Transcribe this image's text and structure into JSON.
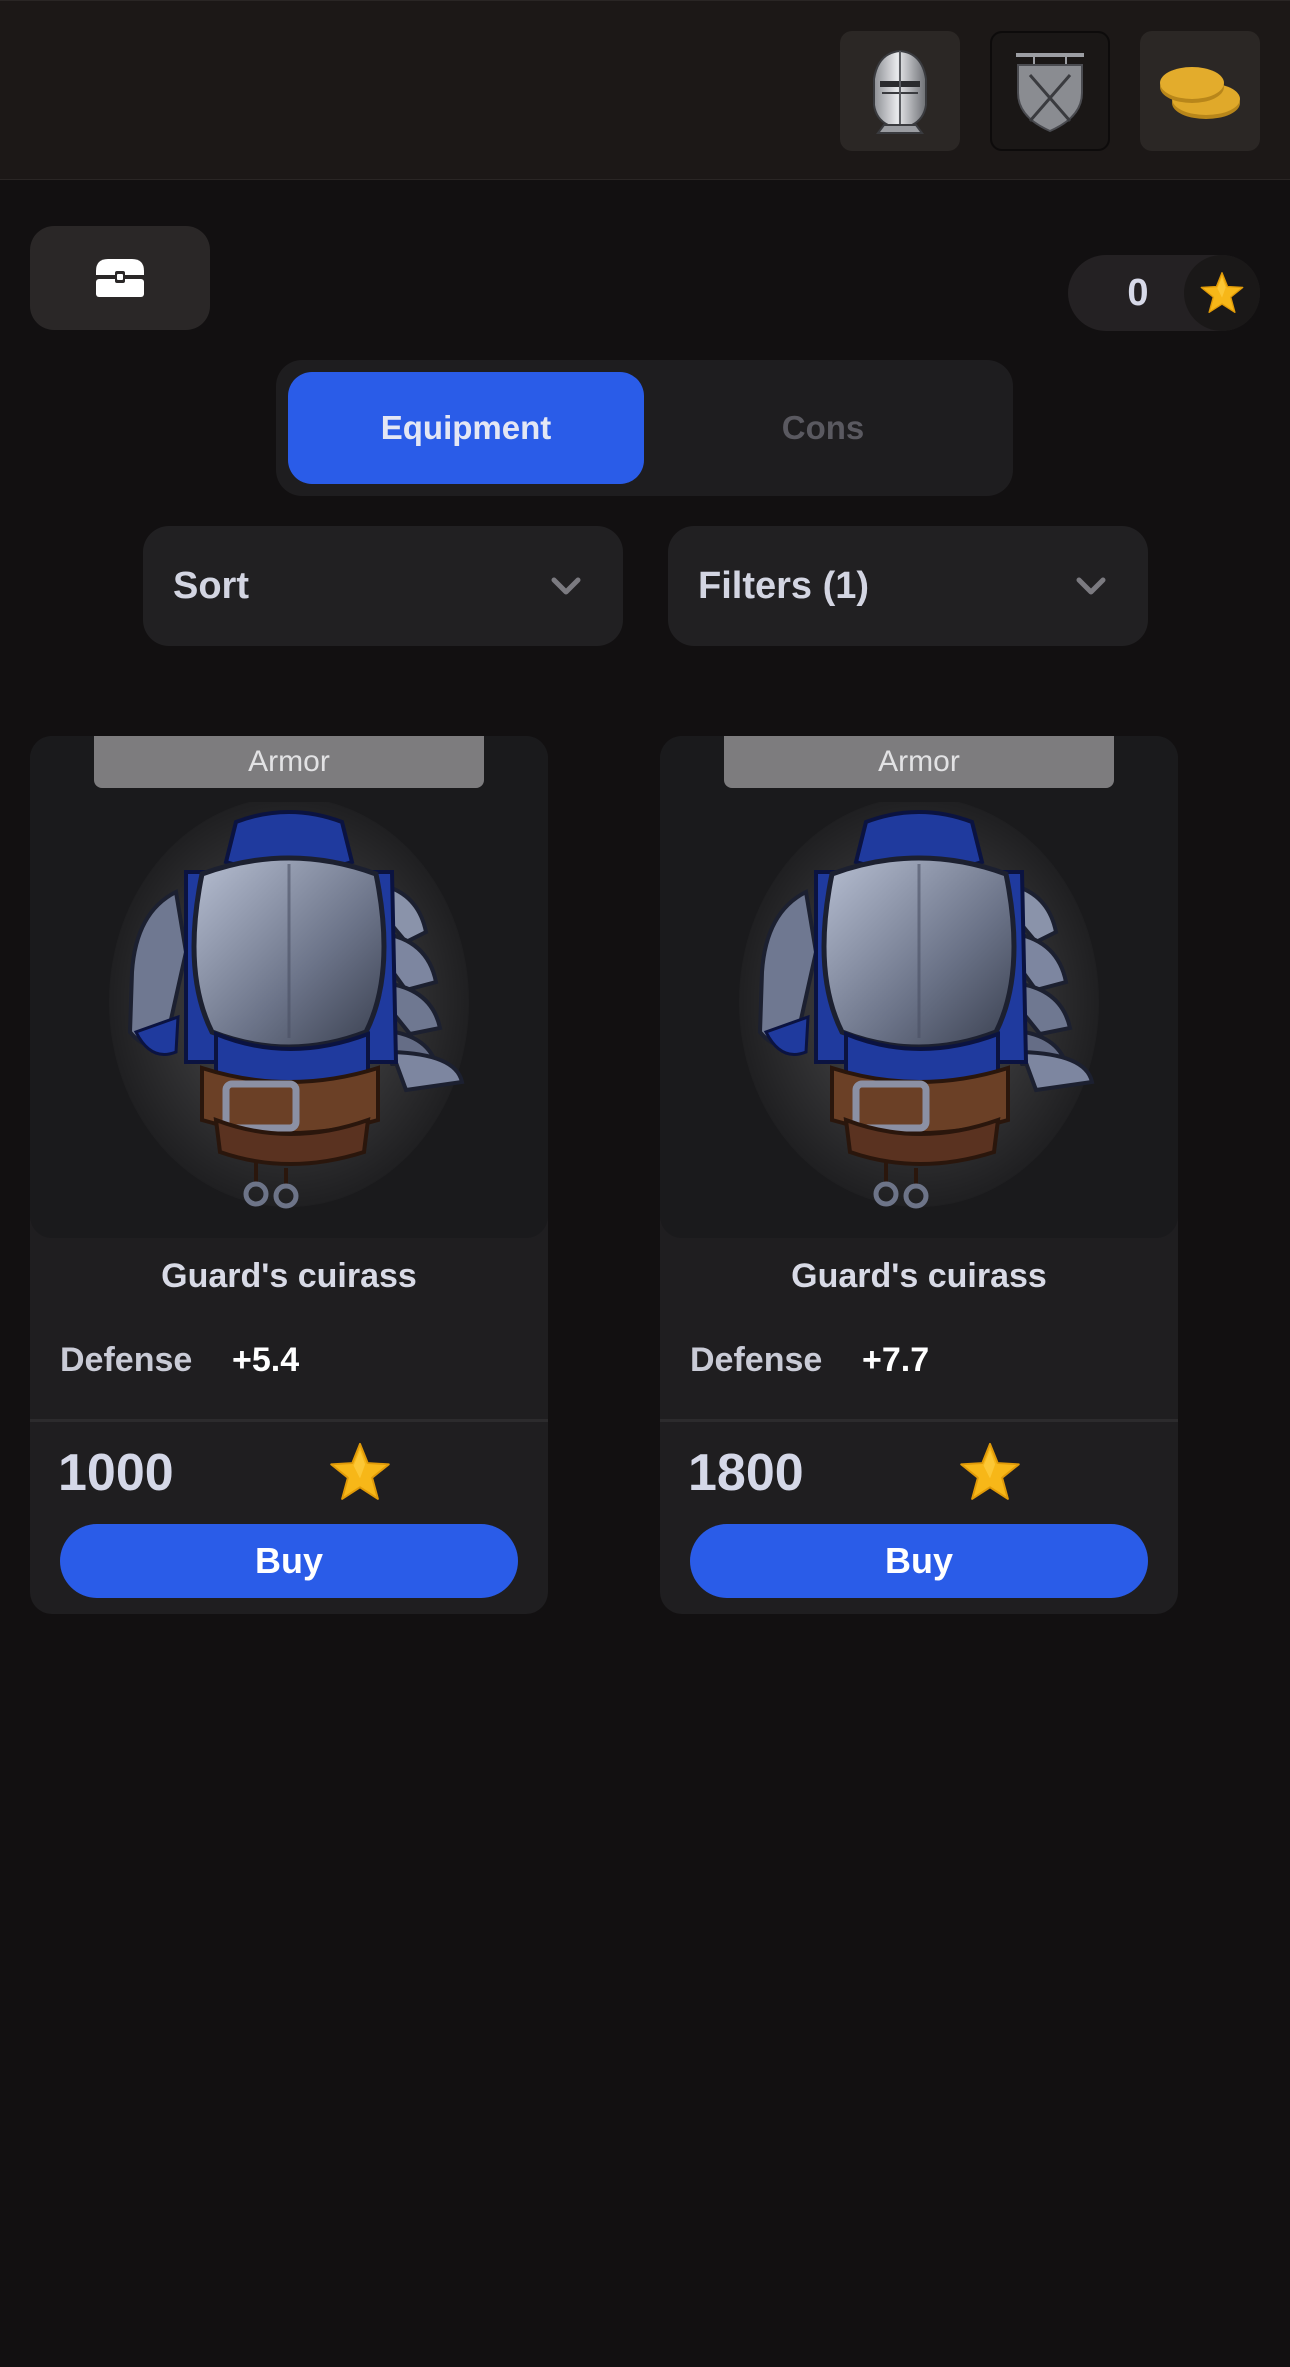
{
  "topbar": {
    "icons": [
      "knight-helmet-icon",
      "shop-sign-icon",
      "coins-icon"
    ]
  },
  "wallet": {
    "balance": "0",
    "currency_icon": "star-icon"
  },
  "tabs": [
    {
      "label": "Equipment",
      "active": true
    },
    {
      "label": "Cons",
      "active": false
    }
  ],
  "controls": {
    "sort_label": "Sort",
    "filters_label": "Filters (1)"
  },
  "products": [
    {
      "category": "Armor",
      "name": "Guard's cuirass",
      "stat_label": "Defense",
      "stat_value": "+5.4",
      "price": "1000",
      "buy_label": "Buy"
    },
    {
      "category": "Armor",
      "name": "Guard's cuirass",
      "stat_label": "Defense",
      "stat_value": "+7.7",
      "price": "1800",
      "buy_label": "Buy"
    }
  ],
  "colors": {
    "accent": "#2a5ce8",
    "star": "#f5b51c",
    "background": "#121011"
  }
}
